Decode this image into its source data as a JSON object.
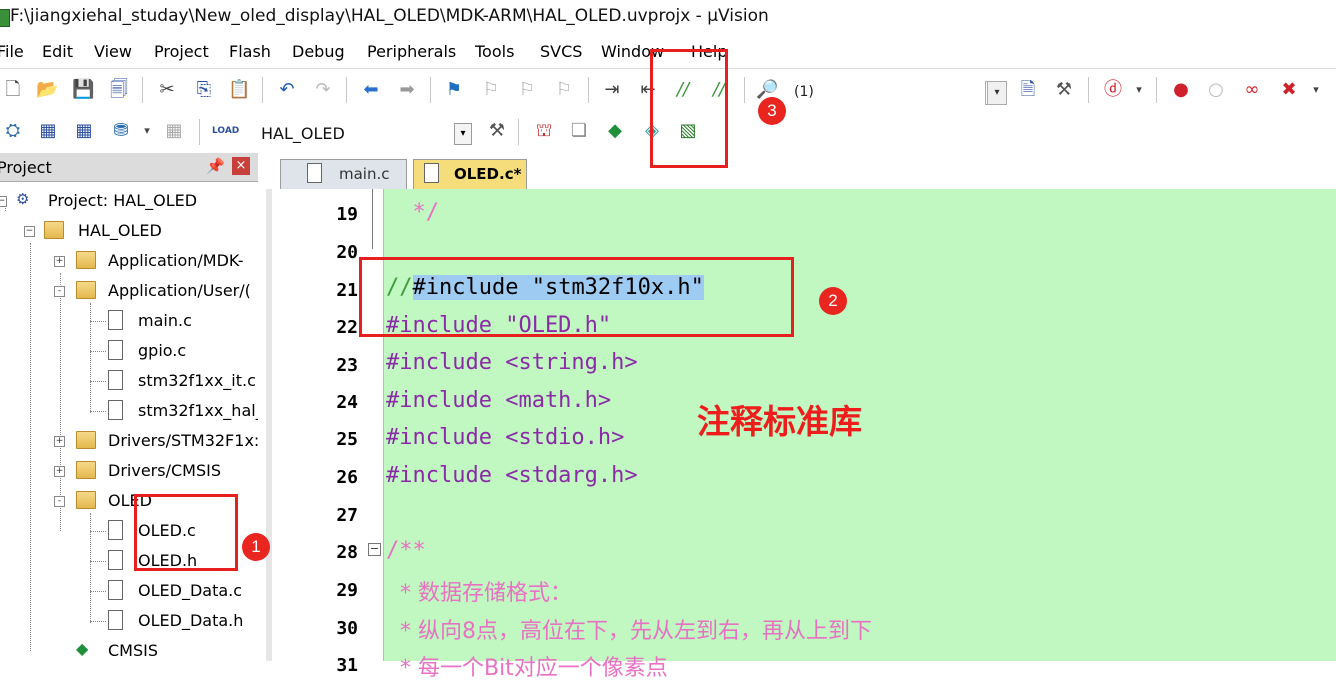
{
  "window": {
    "title": "F:\\jiangxiehal_studay\\New_oled_display\\HAL_OLED\\MDK-ARM\\HAL_OLED.uvprojx - µVision"
  },
  "menu": [
    "File",
    "Edit",
    "View",
    "Project",
    "Flash",
    "Debug",
    "Peripherals",
    "Tools",
    "SVCS",
    "Window",
    "Help"
  ],
  "toolbar": {
    "find_count": "(1)",
    "target_name": "HAL_OLED"
  },
  "project_panel": {
    "title": "Project",
    "pin": "P",
    "close": "×",
    "tree": [
      {
        "label": "Project: HAL_OLED",
        "type": "project"
      },
      {
        "label": "HAL_OLED",
        "type": "target"
      },
      {
        "label": "Application/MDK-",
        "type": "folder",
        "expander": "+"
      },
      {
        "label": "Application/User/(",
        "type": "folder",
        "expander": "-"
      },
      {
        "label": "main.c",
        "type": "file"
      },
      {
        "label": "gpio.c",
        "type": "file"
      },
      {
        "label": "stm32f1xx_it.c",
        "type": "file"
      },
      {
        "label": "stm32f1xx_hal_",
        "type": "file"
      },
      {
        "label": "Drivers/STM32F1x:",
        "type": "folder",
        "expander": "+"
      },
      {
        "label": "Drivers/CMSIS",
        "type": "folder",
        "expander": "+"
      },
      {
        "label": "OLED",
        "type": "folder",
        "expander": "-"
      },
      {
        "label": "OLED.c",
        "type": "file"
      },
      {
        "label": "OLED.h",
        "type": "file"
      },
      {
        "label": "OLED_Data.c",
        "type": "file"
      },
      {
        "label": "OLED_Data.h",
        "type": "file"
      },
      {
        "label": "CMSIS",
        "type": "component"
      }
    ]
  },
  "tabs": [
    {
      "label": "main.c",
      "active": false
    },
    {
      "label": "OLED.c*",
      "active": true
    }
  ],
  "editor": {
    "lines": [
      {
        "num": "19",
        "text": "  */"
      },
      {
        "num": "20",
        "text": ""
      },
      {
        "num": "21",
        "comment": "//",
        "selected": "#include \"stm32f10x.h\""
      },
      {
        "num": "22",
        "text": "#include \"OLED.h\""
      },
      {
        "num": "23",
        "text": "#include <string.h>"
      },
      {
        "num": "24",
        "text": "#include <math.h>"
      },
      {
        "num": "25",
        "text": "#include <stdio.h>"
      },
      {
        "num": "26",
        "text": "#include <stdarg.h>"
      },
      {
        "num": "27",
        "text": ""
      },
      {
        "num": "28",
        "text": "/**"
      },
      {
        "num": "29",
        "text": "  * 数据存储格式："
      },
      {
        "num": "30",
        "text": "  * 纵向8点，高位在下，先从左到右，再从上到下"
      },
      {
        "num": "31",
        "text": "  * 每一个Bit对应一个像素点"
      }
    ]
  },
  "annotations": {
    "badges": [
      "1",
      "2",
      "3"
    ],
    "note": "注释标准库",
    "color": "#e81f1f"
  }
}
